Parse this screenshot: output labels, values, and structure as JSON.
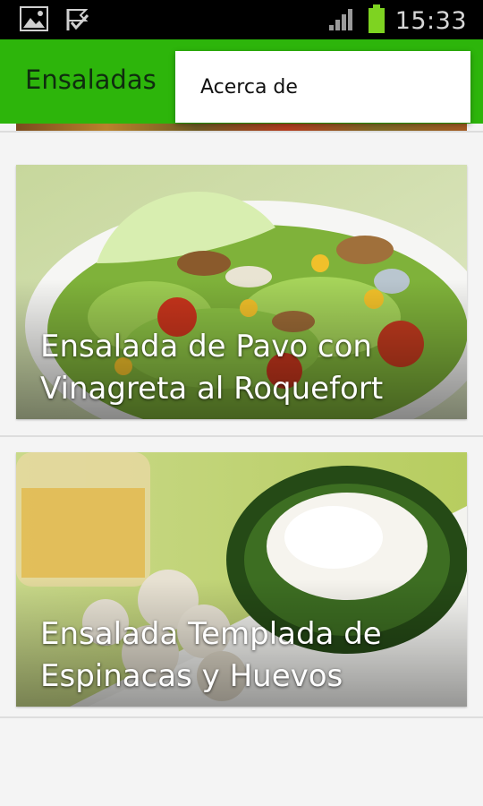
{
  "status_bar": {
    "time": "15:33",
    "icons": [
      "image-icon",
      "checkmark-flag-icon",
      "signal-icon",
      "battery-icon"
    ],
    "battery_color": "#7ed321"
  },
  "action_bar": {
    "title": "Ensaladas",
    "color": "#2db50b"
  },
  "overflow_menu": {
    "items": [
      {
        "label": "Acerca de"
      }
    ]
  },
  "recipes": [
    {
      "title": "Ensalada de Pavo con\nVinagreta al Roquefort"
    },
    {
      "title": "Ensalada Templada de\nEspinacas y Huevos"
    }
  ]
}
